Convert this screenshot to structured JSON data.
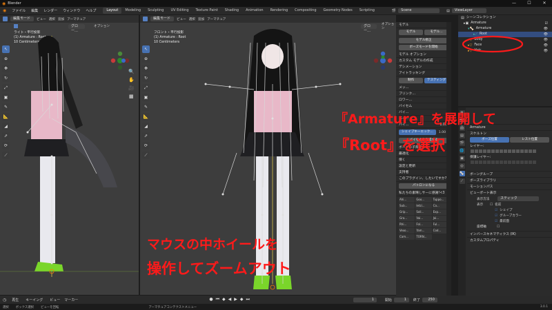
{
  "app": {
    "title": "Blender",
    "window_controls": [
      "—",
      "☐",
      "✕"
    ]
  },
  "menu": {
    "items": [
      "ファイル",
      "編集",
      "レンダー",
      "ウィンドウ",
      "ヘルプ"
    ]
  },
  "workspaces": [
    "Layout",
    "Modeling",
    "Sculpting",
    "UV Editing",
    "Texture Paint",
    "Shading",
    "Animation",
    "Rendering",
    "Compositing",
    "Geometry Nodes",
    "Scripting"
  ],
  "scene": {
    "label": "Scene",
    "view_layer": "ViewLayer"
  },
  "header": {
    "editor_mode": "編集モード",
    "view": "ビュー",
    "select": "選択",
    "add": "追加",
    "armature": "アーマチュア",
    "options": "オプション",
    "orientation": "グロー…"
  },
  "viewport_left": {
    "view_name": "ライト・平行投影",
    "object": "(1) Armature : Root",
    "scale": "10 Centimeters"
  },
  "viewport_right": {
    "view_name": "フロント・平行投影",
    "object": "(1) Armature : Root",
    "scale": "10 Centimeters"
  },
  "npanel": {
    "model_header": "モデル",
    "model_btn": "モデル",
    "model_btn2": "モデル…",
    "model_fix": "モデル修正",
    "pose_mode": "ボーズモードを開始",
    "model_options": "モデル オプション",
    "custom_model": "カスタム モデルの作成",
    "decimation": "デシメーション",
    "eye_tracking": "アイトラッキング",
    "creation": "制作",
    "testing": "テスティング",
    "bone_label": "メッ…",
    "blink": "ブリンク…",
    "lower": "ロワー…",
    "visemes": "バイセム",
    "mouth_a": "バイ…",
    "mouth_o": "バイ…",
    "mouth_ch": "バイ…",
    "shape_value": "1.00",
    "shape_intensity": "シェイプキーエック…",
    "shape_value2": "1.00",
    "create_visemes": "バイセムを作成する",
    "bone_parenting": "ボーンの子育て",
    "optimization": "最適化",
    "copy_protection": "保く",
    "settings_updates": "設定と更新",
    "supporters": "支持者",
    "plugin_q": "このプラグイン、したいですか?",
    "patreon": "パトロンになる",
    "supporters_msg": "私たちの素晴しサーに感謝!<3",
    "supporter_names": [
      "Ahi...",
      "Goo...",
      "Tuppo...",
      "Sub...",
      "Ietzi...",
      "Ca...",
      "Grip...",
      "Soli...",
      "Exp...",
      "Gra...",
      "Vai...",
      "Joi...",
      "Rhi...",
      "Fol...",
      "Ful...",
      "Vexo...",
      "Yam...",
      "Cod...",
      "Cam...",
      "TORN..."
    ]
  },
  "outliner": {
    "scene_collection": "シーンコレクション",
    "items": [
      {
        "label": "Armature",
        "depth": 0
      },
      {
        "label": "Armature",
        "depth": 1
      },
      {
        "label": "Root",
        "depth": 2,
        "selected": true
      },
      {
        "label": "Body",
        "depth": 1
      },
      {
        "label": "Face",
        "depth": 1
      },
      {
        "label": "Hair",
        "depth": 1
      }
    ]
  },
  "properties": {
    "armature_name": "Armature",
    "skeleton": "スケルトン",
    "pose_position": "ボーズ位置",
    "rest_position": "レスト位置",
    "layers": "レイヤー:",
    "protected_layers": "保護レイヤー:",
    "bone_groups": "ボーングループ",
    "pose_library": "ボーズライブラリ",
    "motion_paths": "モーションパス",
    "viewport_display": "ビューポート表示",
    "display_as_label": "表示方法",
    "display_as": "スティック",
    "show_label": "表示",
    "names": "名前",
    "shapes": "シェイプ",
    "group_colors": "グループカラー",
    "in_front": "最前面",
    "axes": "座標軸",
    "inverse_kinematics": "インバースキネマティクス (IK)",
    "custom_properties": "カスタムプロパティ"
  },
  "annotations": {
    "line1": "『Armature』を展開して",
    "line2": "『Root』を選択",
    "line3": "マウスの中ホイールを",
    "line4": "操作してズームアウト"
  },
  "timeline": {
    "playback": "再生",
    "keying": "キーイング",
    "view": "ビュー",
    "marker": "マーカー",
    "current_frame": "1",
    "start_label": "開始",
    "start": "1",
    "end_label": "終了",
    "end": "250"
  },
  "status": {
    "select": "選択",
    "box_select": "ボックス選択",
    "rotate_view": "ビューを回転",
    "context_menu": "アーマチュアコンテクストメニュー",
    "version": "3.0.1"
  },
  "colors": {
    "accent": "#4772b3",
    "annotation": "#ff1a1a",
    "shirt": "#e8b8c8",
    "bone": "#d8d8d8",
    "skirt": "#1f1f22",
    "shoe": "#7ad62a"
  }
}
